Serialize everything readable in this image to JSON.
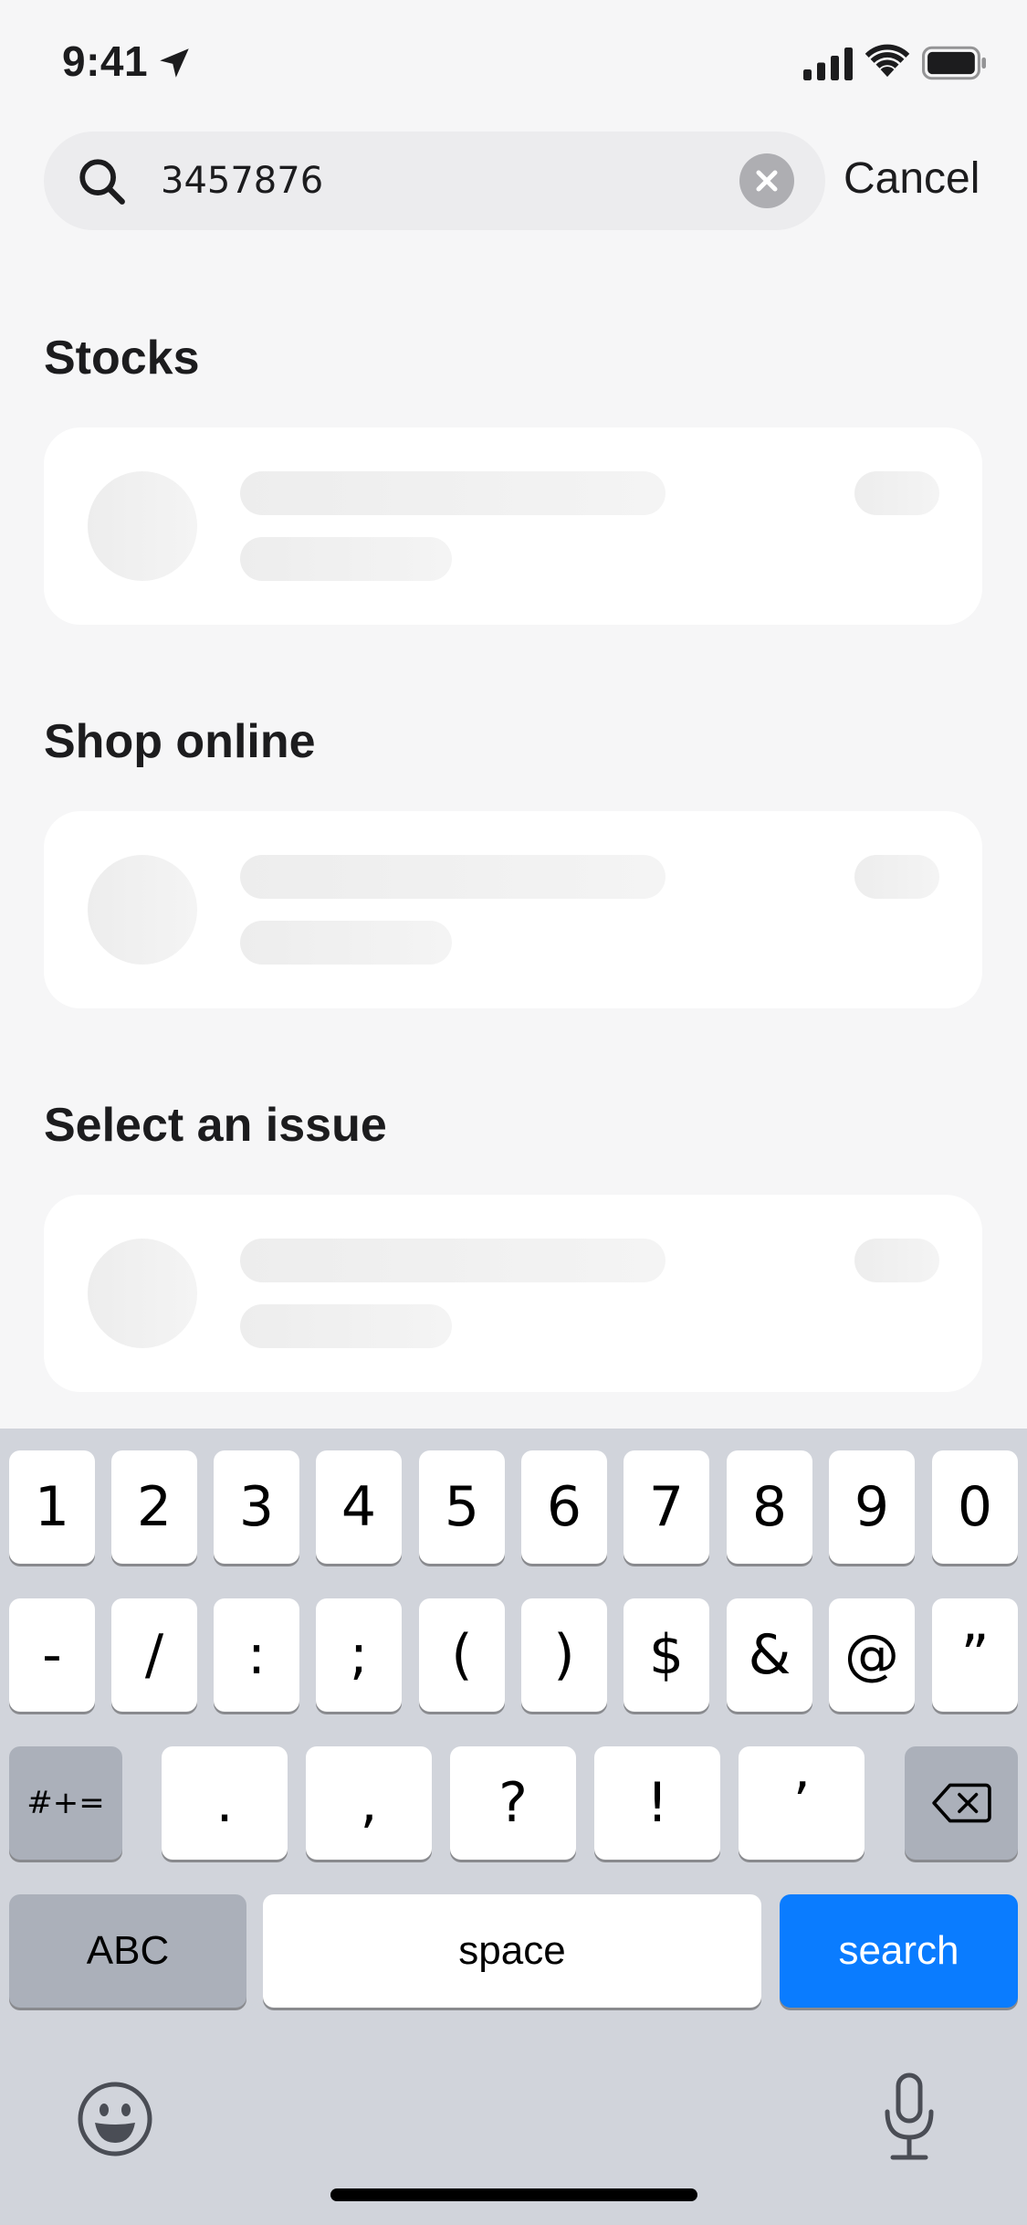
{
  "status_bar": {
    "time": "9:41"
  },
  "search": {
    "value": "3457876",
    "cancel_label": "Cancel"
  },
  "sections": [
    {
      "title": "Stocks"
    },
    {
      "title": "Shop online"
    },
    {
      "title": "Select an issue"
    }
  ],
  "keyboard": {
    "row1": [
      "1",
      "2",
      "3",
      "4",
      "5",
      "6",
      "7",
      "8",
      "9",
      "0"
    ],
    "row2": [
      "-",
      "/",
      ":",
      ";",
      "(",
      ")",
      "$",
      "&",
      "@",
      "”"
    ],
    "row3_toggle": "#+=",
    "row3": [
      ".",
      ",",
      "?",
      "!",
      "’"
    ],
    "abc_label": "ABC",
    "space_label": "space",
    "search_label": "search",
    "accent_color": "#0a7cff"
  }
}
